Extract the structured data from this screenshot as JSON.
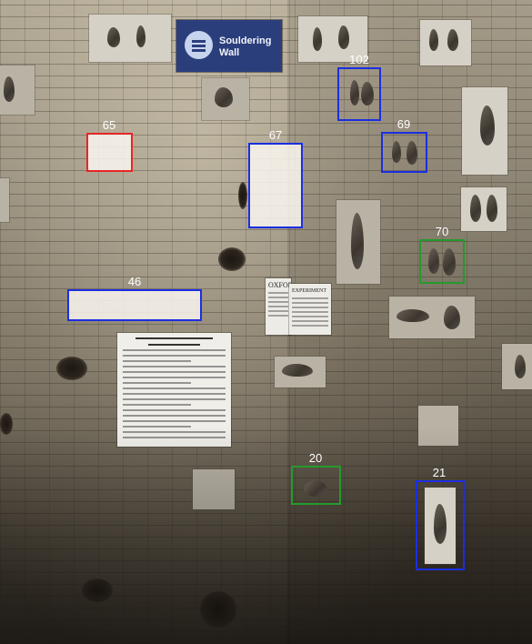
{
  "sign": {
    "line1": "Souldering",
    "line2": "Wall"
  },
  "paper_title": "OXFORD",
  "paper_subtitle": "EXPERIMENT",
  "annotations": [
    {
      "id": "65",
      "color": "red"
    },
    {
      "id": "67",
      "color": "blue"
    },
    {
      "id": "102",
      "color": "blue"
    },
    {
      "id": "69",
      "color": "blue"
    },
    {
      "id": "70",
      "color": "green"
    },
    {
      "id": "46",
      "color": "blue"
    },
    {
      "id": "20",
      "color": "green"
    },
    {
      "id": "21",
      "color": "blue"
    }
  ],
  "colors": {
    "red": "#e8252a",
    "blue": "#1c2ee0",
    "green": "#239a2b",
    "sign": "#2b3e7c"
  }
}
